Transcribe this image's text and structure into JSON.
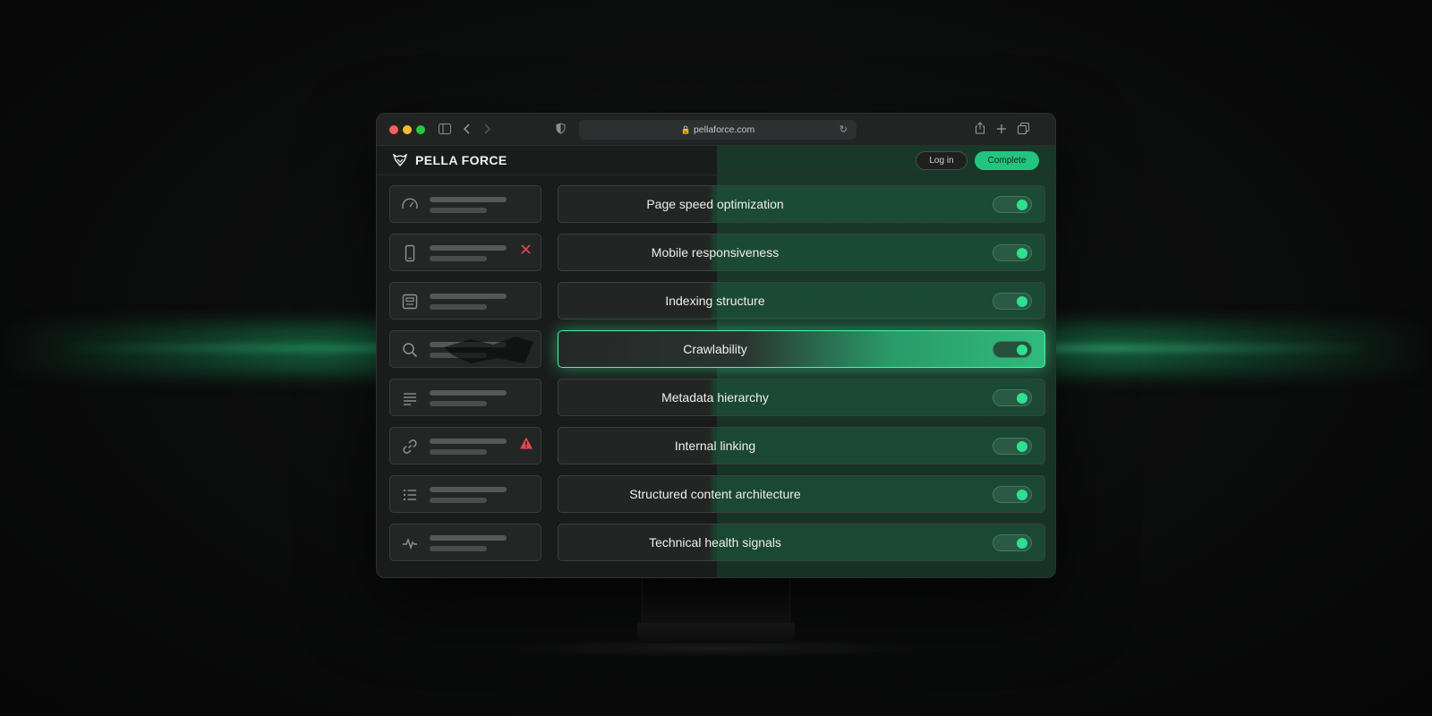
{
  "browser": {
    "url": "pellaforce.com"
  },
  "header": {
    "brand": "PELLA FORCE",
    "login_label": "Log in",
    "complete_label": "Complete"
  },
  "sidebar": {
    "items": [
      {
        "icon": "speedometer-icon",
        "status": "none"
      },
      {
        "icon": "mobile-icon",
        "status": "error"
      },
      {
        "icon": "layout-icon",
        "status": "none"
      },
      {
        "icon": "search-icon",
        "status": "damaged"
      },
      {
        "icon": "text-lines-icon",
        "status": "none"
      },
      {
        "icon": "link-icon",
        "status": "warning"
      },
      {
        "icon": "list-icon",
        "status": "none"
      },
      {
        "icon": "pulse-icon",
        "status": "none"
      }
    ]
  },
  "checks": [
    {
      "label": "Page speed optimization",
      "enabled": true
    },
    {
      "label": "Mobile responsiveness",
      "enabled": true
    },
    {
      "label": "Indexing structure",
      "enabled": true
    },
    {
      "label": "Crawlability",
      "enabled": true,
      "active": true
    },
    {
      "label": "Metadata hierarchy",
      "enabled": true
    },
    {
      "label": "Internal linking",
      "enabled": true
    },
    {
      "label": "Structured content architecture",
      "enabled": true
    },
    {
      "label": "Technical health signals",
      "enabled": true
    }
  ],
  "colors": {
    "accent": "#22c47f",
    "error": "#e5484d",
    "warning": "#e5484d"
  }
}
